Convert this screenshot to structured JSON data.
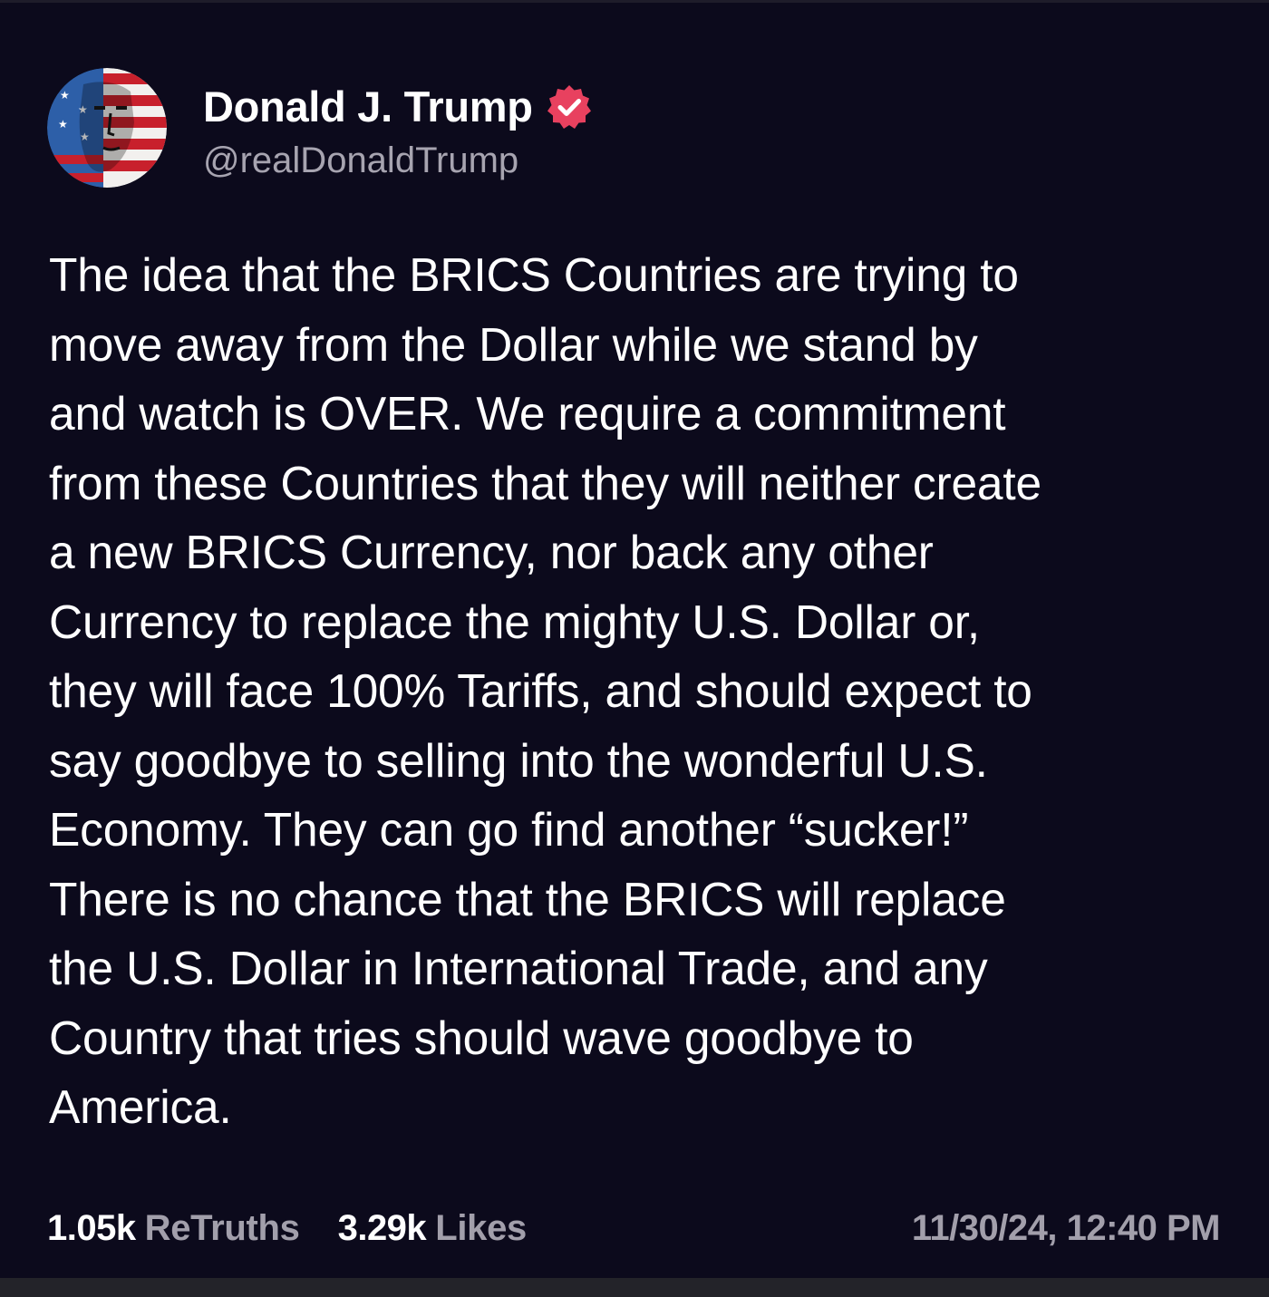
{
  "post": {
    "author": {
      "display_name": "Donald J. Trump",
      "handle": "@realDonaldTrump",
      "avatar": "american-flag-face-portrait",
      "verified": true,
      "verified_icon": "verified-badge-icon",
      "verified_color": "#e8415f"
    },
    "text": "The idea that the BRICS Countries are trying to\nmove away from the Dollar while we stand by\nand watch is OVER. We require a commitment\nfrom these Countries that they will neither create\na new BRICS Currency, nor back any other\nCurrency to replace the mighty U.S. Dollar or,\nthey will face 100% Tariffs, and should expect to\nsay goodbye to selling into the wonderful U.S.\nEconomy. They can go find another “sucker!”\nThere is no chance that the BRICS will replace\nthe U.S. Dollar in International Trade, and any\nCountry that tries should wave goodbye to\nAmerica.",
    "stats": {
      "retruths_count": "1.05k",
      "retruths_label": "ReTruths",
      "likes_count": "3.29k",
      "likes_label": "Likes"
    },
    "timestamp": "11/30/24, 12:40 PM"
  },
  "theme": {
    "background": "#0c0a1c",
    "text_primary": "#ffffff",
    "text_secondary": "#a29fab"
  }
}
